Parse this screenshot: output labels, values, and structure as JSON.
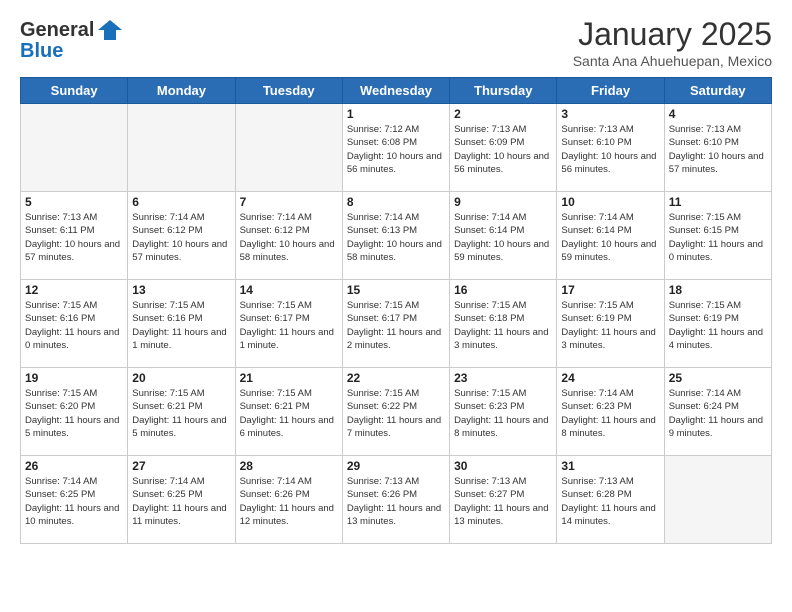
{
  "logo": {
    "general": "General",
    "blue": "Blue"
  },
  "header": {
    "month": "January 2025",
    "location": "Santa Ana Ahuehuepan, Mexico"
  },
  "weekdays": [
    "Sunday",
    "Monday",
    "Tuesday",
    "Wednesday",
    "Thursday",
    "Friday",
    "Saturday"
  ],
  "weeks": [
    [
      {
        "day": "",
        "empty": true
      },
      {
        "day": "",
        "empty": true
      },
      {
        "day": "",
        "empty": true
      },
      {
        "day": "1",
        "sunrise": "7:12 AM",
        "sunset": "6:08 PM",
        "daylight": "10 hours and 56 minutes."
      },
      {
        "day": "2",
        "sunrise": "7:13 AM",
        "sunset": "6:09 PM",
        "daylight": "10 hours and 56 minutes."
      },
      {
        "day": "3",
        "sunrise": "7:13 AM",
        "sunset": "6:10 PM",
        "daylight": "10 hours and 56 minutes."
      },
      {
        "day": "4",
        "sunrise": "7:13 AM",
        "sunset": "6:10 PM",
        "daylight": "10 hours and 57 minutes."
      }
    ],
    [
      {
        "day": "5",
        "sunrise": "7:13 AM",
        "sunset": "6:11 PM",
        "daylight": "10 hours and 57 minutes."
      },
      {
        "day": "6",
        "sunrise": "7:14 AM",
        "sunset": "6:12 PM",
        "daylight": "10 hours and 57 minutes."
      },
      {
        "day": "7",
        "sunrise": "7:14 AM",
        "sunset": "6:12 PM",
        "daylight": "10 hours and 58 minutes."
      },
      {
        "day": "8",
        "sunrise": "7:14 AM",
        "sunset": "6:13 PM",
        "daylight": "10 hours and 58 minutes."
      },
      {
        "day": "9",
        "sunrise": "7:14 AM",
        "sunset": "6:14 PM",
        "daylight": "10 hours and 59 minutes."
      },
      {
        "day": "10",
        "sunrise": "7:14 AM",
        "sunset": "6:14 PM",
        "daylight": "10 hours and 59 minutes."
      },
      {
        "day": "11",
        "sunrise": "7:15 AM",
        "sunset": "6:15 PM",
        "daylight": "11 hours and 0 minutes."
      }
    ],
    [
      {
        "day": "12",
        "sunrise": "7:15 AM",
        "sunset": "6:16 PM",
        "daylight": "11 hours and 0 minutes."
      },
      {
        "day": "13",
        "sunrise": "7:15 AM",
        "sunset": "6:16 PM",
        "daylight": "11 hours and 1 minute."
      },
      {
        "day": "14",
        "sunrise": "7:15 AM",
        "sunset": "6:17 PM",
        "daylight": "11 hours and 1 minute."
      },
      {
        "day": "15",
        "sunrise": "7:15 AM",
        "sunset": "6:17 PM",
        "daylight": "11 hours and 2 minutes."
      },
      {
        "day": "16",
        "sunrise": "7:15 AM",
        "sunset": "6:18 PM",
        "daylight": "11 hours and 3 minutes."
      },
      {
        "day": "17",
        "sunrise": "7:15 AM",
        "sunset": "6:19 PM",
        "daylight": "11 hours and 3 minutes."
      },
      {
        "day": "18",
        "sunrise": "7:15 AM",
        "sunset": "6:19 PM",
        "daylight": "11 hours and 4 minutes."
      }
    ],
    [
      {
        "day": "19",
        "sunrise": "7:15 AM",
        "sunset": "6:20 PM",
        "daylight": "11 hours and 5 minutes."
      },
      {
        "day": "20",
        "sunrise": "7:15 AM",
        "sunset": "6:21 PM",
        "daylight": "11 hours and 5 minutes."
      },
      {
        "day": "21",
        "sunrise": "7:15 AM",
        "sunset": "6:21 PM",
        "daylight": "11 hours and 6 minutes."
      },
      {
        "day": "22",
        "sunrise": "7:15 AM",
        "sunset": "6:22 PM",
        "daylight": "11 hours and 7 minutes."
      },
      {
        "day": "23",
        "sunrise": "7:15 AM",
        "sunset": "6:23 PM",
        "daylight": "11 hours and 8 minutes."
      },
      {
        "day": "24",
        "sunrise": "7:14 AM",
        "sunset": "6:23 PM",
        "daylight": "11 hours and 8 minutes."
      },
      {
        "day": "25",
        "sunrise": "7:14 AM",
        "sunset": "6:24 PM",
        "daylight": "11 hours and 9 minutes."
      }
    ],
    [
      {
        "day": "26",
        "sunrise": "7:14 AM",
        "sunset": "6:25 PM",
        "daylight": "11 hours and 10 minutes."
      },
      {
        "day": "27",
        "sunrise": "7:14 AM",
        "sunset": "6:25 PM",
        "daylight": "11 hours and 11 minutes."
      },
      {
        "day": "28",
        "sunrise": "7:14 AM",
        "sunset": "6:26 PM",
        "daylight": "11 hours and 12 minutes."
      },
      {
        "day": "29",
        "sunrise": "7:13 AM",
        "sunset": "6:26 PM",
        "daylight": "11 hours and 13 minutes."
      },
      {
        "day": "30",
        "sunrise": "7:13 AM",
        "sunset": "6:27 PM",
        "daylight": "11 hours and 13 minutes."
      },
      {
        "day": "31",
        "sunrise": "7:13 AM",
        "sunset": "6:28 PM",
        "daylight": "11 hours and 14 minutes."
      },
      {
        "day": "",
        "empty": true
      }
    ]
  ]
}
